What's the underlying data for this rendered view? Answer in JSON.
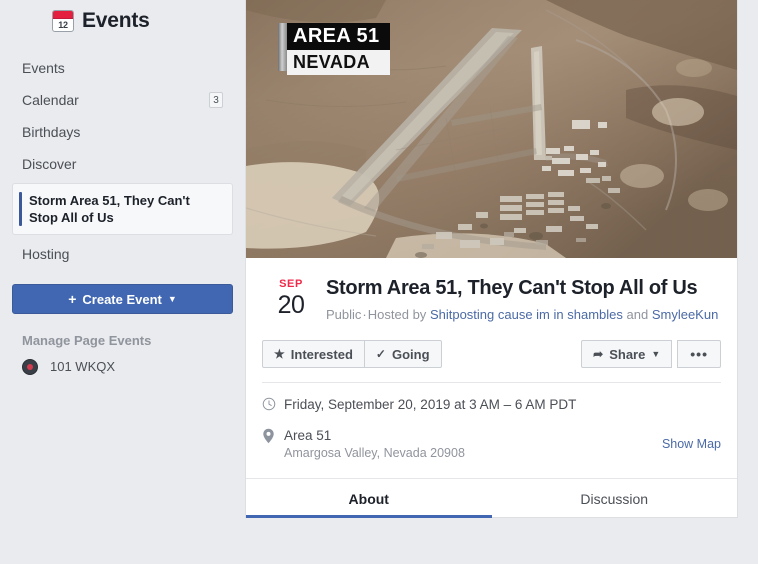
{
  "sidebar": {
    "icon": "calendar-icon",
    "calendar_icon_day": "12",
    "title": "Events",
    "items": [
      {
        "label": "Events",
        "badge": null
      },
      {
        "label": "Calendar",
        "badge": "3"
      },
      {
        "label": "Birthdays",
        "badge": null
      },
      {
        "label": "Discover",
        "badge": null
      }
    ],
    "selected_item": {
      "label": "Storm Area 51, They Can't Stop All of Us"
    },
    "items_after": [
      {
        "label": "Hosting",
        "badge": null
      }
    ],
    "create_button": {
      "plus": "+",
      "label": "Create Event",
      "caret": "▼"
    },
    "manage_section_title": "Manage Page Events",
    "pages": [
      {
        "name": "101 WKQX",
        "avatar": "page-avatar-icon"
      }
    ]
  },
  "cover": {
    "label_top": "AREA 51",
    "label_bottom": "NEVADA",
    "alt": "aerial-photo-of-desert-airbase"
  },
  "event": {
    "date_month": "SEP",
    "date_day": "20",
    "title": "Storm Area 51, They Can't Stop All of Us",
    "privacy": "Public",
    "separator": "·",
    "hosted_by_prefix": "Hosted by",
    "hosts": [
      {
        "name": "Shitposting cause im in shambles"
      },
      {
        "name": "SmyleeKun"
      }
    ],
    "host_conjunction": "and"
  },
  "actions": {
    "interested_label": "Interested",
    "interested_icon": "star-icon",
    "going_label": "Going",
    "going_icon": "check-icon",
    "share_label": "Share",
    "share_icon": "share-arrow-icon",
    "share_caret": "▼",
    "more_label": "•••",
    "more_icon": "ellipsis-icon"
  },
  "details": {
    "time_icon": "clock-icon",
    "time_text": "Friday, September 20, 2019 at 3 AM – 6 AM PDT",
    "location_icon": "map-pin-icon",
    "location_name": "Area 51",
    "location_address": "Amargosa Valley, Nevada 20908",
    "show_map_label": "Show Map"
  },
  "tabs": [
    {
      "label": "About",
      "active": true
    },
    {
      "label": "Discussion",
      "active": false
    }
  ],
  "colors": {
    "page_background": "#e9ebee",
    "card_background": "#ffffff",
    "brand_blue": "#4267b2",
    "link_blue": "#4b6aa5",
    "accent_red": "#f02849",
    "muted_text": "#90949c",
    "body_text": "#4b4f56"
  }
}
